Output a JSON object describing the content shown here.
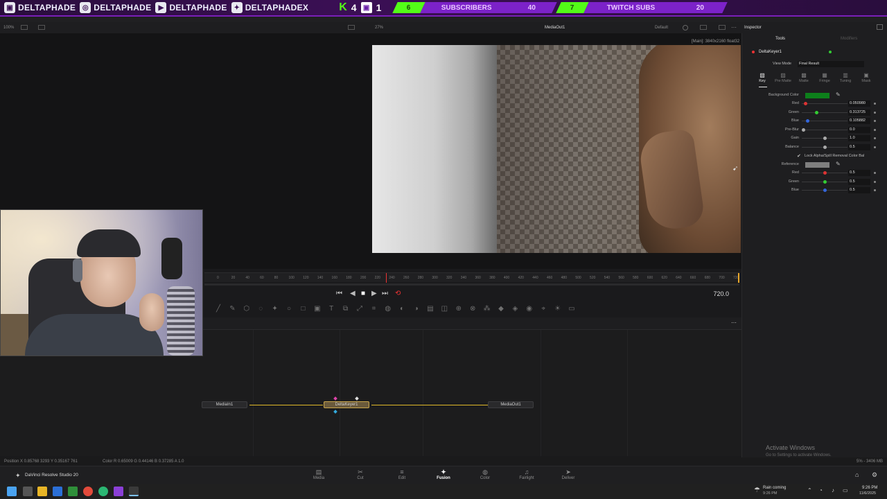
{
  "overlay": {
    "socials": [
      {
        "icon": "twitch-icon",
        "glyph": "▣",
        "name": "DELTAPHADE"
      },
      {
        "icon": "instagram-icon",
        "glyph": "◎",
        "name": "DELTAPHADE"
      },
      {
        "icon": "youtube-icon",
        "glyph": "▶",
        "name": "DELTAPHADE"
      },
      {
        "icon": "twitter-icon",
        "glyph": "✦",
        "name": "DELTAPHADEX"
      }
    ],
    "kick_glyph": "K",
    "kick_count": "4",
    "twitch_glyph": "▣",
    "twitch_count": "1",
    "goal1_current": "6",
    "goal1_label": "SUBSCRIBERS",
    "goal1_target": "40",
    "goal2_current": "7",
    "goal2_label": "TWITCH SUBS",
    "goal2_target": "20"
  },
  "toolbar": {
    "zoom_left": "100%",
    "zoom_viewer": "27%",
    "viewer_title": "MediaOut1",
    "layout_preset": "Default",
    "inspector_title": "Inspector"
  },
  "viewer": {
    "resolution": "[Main]: 3840x2160 float32"
  },
  "ruler": {
    "ticks": [
      "0",
      "20",
      "40",
      "60",
      "80",
      "100",
      "120",
      "140",
      "160",
      "180",
      "200",
      "220",
      "240",
      "260",
      "280",
      "300",
      "320",
      "340",
      "360",
      "380",
      "400",
      "420",
      "440",
      "460",
      "480",
      "500",
      "520",
      "540",
      "560",
      "580",
      "600",
      "620",
      "640",
      "660",
      "680",
      "700",
      "720"
    ]
  },
  "transport": {
    "frame": "720.0"
  },
  "nodes": {
    "media_in": "MediaIn1",
    "delta_keyer": "DeltaKeyer1",
    "media_out": "MediaOut1"
  },
  "status": {
    "position": "Position  X 0.85768   3293   Y 0.35167   761",
    "color": "Color  R 0.65009   G 0.44146   B 0.37285   A 1.0",
    "memory": "5% - 3406 MB"
  },
  "pages": {
    "app_name": "DaVinci Resolve Studio 20",
    "items": [
      {
        "label": "Media",
        "glyph": "▤"
      },
      {
        "label": "Cut",
        "glyph": "✂"
      },
      {
        "label": "Edit",
        "glyph": "≡"
      },
      {
        "label": "Fusion",
        "glyph": "✦"
      },
      {
        "label": "Color",
        "glyph": "◍"
      },
      {
        "label": "Fairlight",
        "glyph": "♫"
      },
      {
        "label": "Deliver",
        "glyph": "➤"
      }
    ]
  },
  "inspector": {
    "tab_tools": "Tools",
    "tab_modifiers": "Modifiers",
    "node_name": "DeltaKeyer1",
    "view_mode_label": "View Mode",
    "view_mode_value": "Final Result",
    "subtabs": [
      {
        "label": "Key",
        "glyph": "▧"
      },
      {
        "label": "Pre Matte",
        "glyph": "▨"
      },
      {
        "label": "Matte",
        "glyph": "▩"
      },
      {
        "label": "Fringe",
        "glyph": "▦"
      },
      {
        "label": "Tuning",
        "glyph": "▥"
      },
      {
        "label": "Mask",
        "glyph": "▣"
      }
    ],
    "bg_color_label": "Background Color",
    "bg_color_hex": "#0d7f1b",
    "params": [
      {
        "label": "Red",
        "value": "0.050980",
        "knob": 0.05,
        "color": "#d33"
      },
      {
        "label": "Green",
        "value": "0.313725",
        "knob": 0.31,
        "color": "#3c3"
      },
      {
        "label": "Blue",
        "value": "0.105882",
        "knob": 0.1,
        "color": "#36d"
      },
      {
        "label": "Pre-Blur",
        "value": "0.0",
        "knob": 0.0,
        "color": "#aaa"
      },
      {
        "label": "Gain",
        "value": "1.0",
        "knob": 0.5,
        "color": "#aaa"
      },
      {
        "label": "Balance",
        "value": "0.5",
        "knob": 0.5,
        "color": "#aaa"
      }
    ],
    "lock_label": "Lock Alpha/Spill Removal Color Bal",
    "reference_label": "Reference",
    "reference_hex": "#7f7f7f",
    "ref_params": [
      {
        "label": "Red",
        "value": "0.5",
        "knob": 0.5,
        "color": "#d33"
      },
      {
        "label": "Green",
        "value": "0.5",
        "knob": 0.5,
        "color": "#3c3"
      },
      {
        "label": "Blue",
        "value": "0.5",
        "knob": 0.5,
        "color": "#36d"
      }
    ]
  },
  "watermark": {
    "line1": "Activate Windows",
    "line2": "Go to Settings to activate Windows."
  },
  "taskbar": {
    "weather": "Rain coming",
    "weather_time": "9:26 PM",
    "time": "9:26 PM",
    "date": "11/6/2025"
  }
}
